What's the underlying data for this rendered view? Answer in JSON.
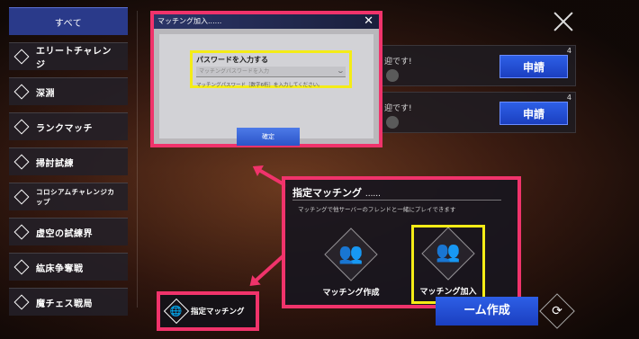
{
  "sidebar": {
    "items": [
      {
        "label": "すべて"
      },
      {
        "label": "エリートチャレンジ"
      },
      {
        "label": "深淵"
      },
      {
        "label": "ランクマッチ"
      },
      {
        "label": "掃討試練"
      },
      {
        "label": "コロシアムチャレンジカップ"
      },
      {
        "label": "虚空の試練界"
      },
      {
        "label": "紘床争奪戦"
      },
      {
        "label": "魔チェス戦局"
      }
    ]
  },
  "rooms": [
    {
      "partial_text": "迎です!",
      "count": "4",
      "button": "申請"
    },
    {
      "partial_text": "迎です!",
      "count": "4",
      "button": "申請"
    }
  ],
  "password_modal": {
    "title": "マッチング加入",
    "title_dots": "......",
    "field_label": "パスワードを入力する",
    "field_placeholder": "マッチングパスワードを入力",
    "hint": "マッチングパスワード［数字6桁］を入力してください。",
    "confirm": "確定"
  },
  "matching_panel": {
    "title": "指定マッチング",
    "title_dots": "......",
    "description": "マッチングで他サーバーのフレンドと一緒にプレイできます",
    "create_label": "マッチング作成",
    "join_label": "マッチング加入"
  },
  "create_room": "ーム作成",
  "designated_matching_button": "指定マッチング",
  "icons": {
    "close": "close-icon",
    "refresh": "refresh-icon",
    "eye": "eye-closed-icon"
  },
  "colors": {
    "highlight_pink": "#f0336b",
    "highlight_yellow": "#f4ec16",
    "button_blue": "#2d5fe6"
  }
}
